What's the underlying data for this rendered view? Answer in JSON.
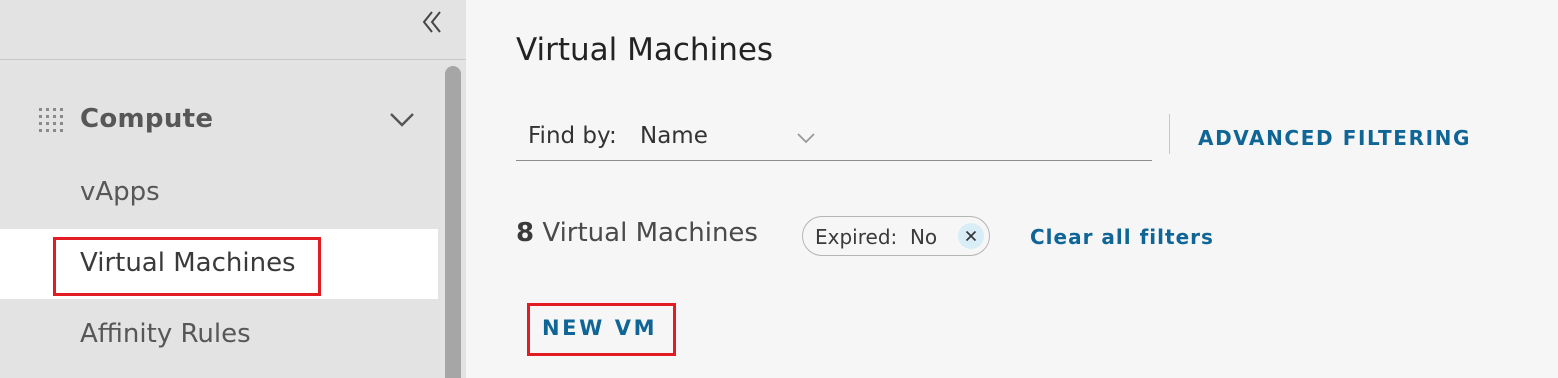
{
  "sidebar": {
    "collapse_icon": "double-chevron-left-icon",
    "group": {
      "icon": "grid-icon",
      "label": "Compute",
      "expand_icon": "chevron-down-icon"
    },
    "items": [
      {
        "label": "vApps",
        "active": false
      },
      {
        "label": "Virtual Machines",
        "active": true,
        "highlighted": true
      },
      {
        "label": "Affinity Rules",
        "active": false
      }
    ]
  },
  "main": {
    "title": "Virtual Machines",
    "find_by": {
      "prefix": "Find by:",
      "value": "Name",
      "dropdown_icon": "chevron-down-icon"
    },
    "advanced_filtering": "ADVANCED FILTERING",
    "count": {
      "number": "8",
      "label": "Virtual Machines"
    },
    "filter_pill": {
      "text": "Expired:  No",
      "remove_icon": "close-icon"
    },
    "clear_filters": "Clear all filters",
    "new_vm": "NEW VM",
    "new_vm_highlighted": true
  },
  "colors": {
    "accent": "#0e6596",
    "highlight": "#e31b23",
    "sidebar_bg": "#e3e3e3",
    "main_bg": "#f6f6f6"
  }
}
